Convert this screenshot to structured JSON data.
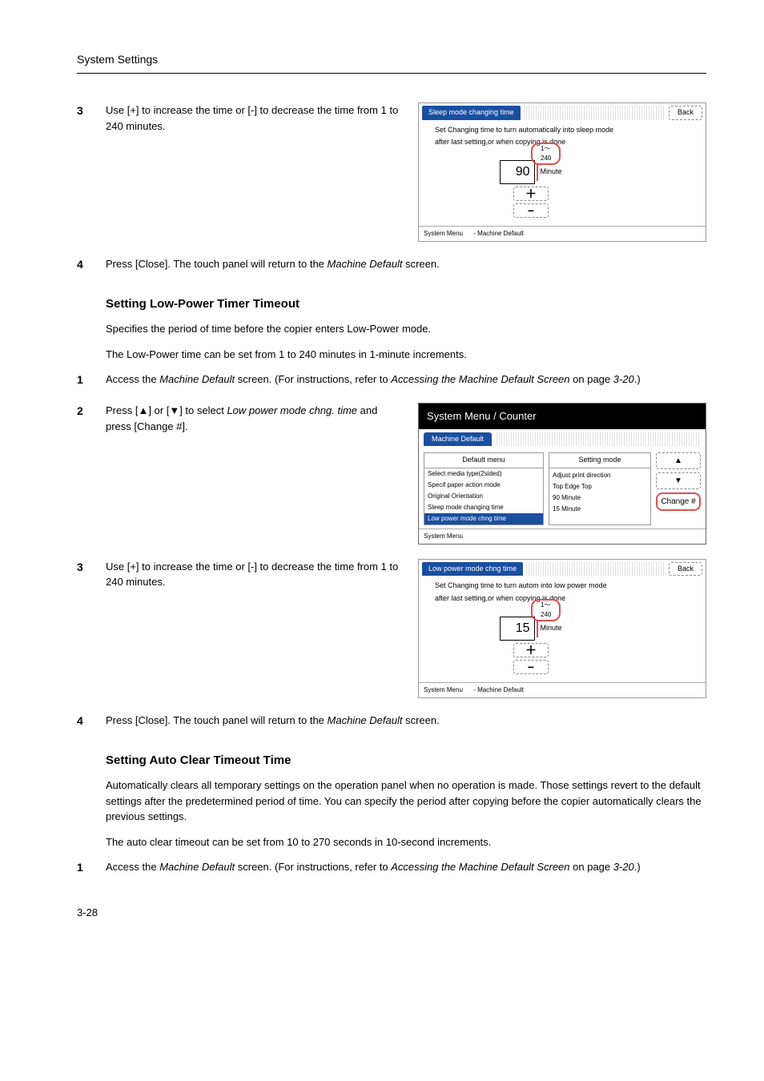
{
  "header": {
    "section": "System Settings"
  },
  "step3a": {
    "num": "3",
    "text": "Use [+] to increase the time or [-] to decrease the time from 1 to 240 minutes."
  },
  "panel1": {
    "title": "Sleep mode changing time",
    "back": "Back",
    "desc1": "Set Changing time to turn automatically into sleep mode",
    "desc2": "after last setting,or when copying is done",
    "range": "1～240",
    "value": "90",
    "unit": "Minute",
    "plus": "＋",
    "minus": "−",
    "footerLeft": "System Menu",
    "footerRight": "-  Machine Default"
  },
  "step4a": {
    "num": "4",
    "textA": "Press [Close]. The touch panel will return to the ",
    "textItalic": "Machine Default",
    "textB": " screen."
  },
  "sectionA": {
    "heading": "Setting Low-Power Timer Timeout",
    "p1": "Specifies the period of time before the copier enters Low-Power mode.",
    "p2": "The Low-Power time can be set from 1 to 240 minutes in 1-minute increments."
  },
  "step1b": {
    "num": "1",
    "textA": "Access the ",
    "textItalic1": "Machine Default",
    "textB": " screen. (For instructions, refer to ",
    "textItalic2": "Accessing the Machine Default Screen",
    "textC": " on page ",
    "textItalic3": "3-20",
    "textD": ".)"
  },
  "step2b": {
    "num": "2",
    "textA": "Press [▲] or [▼] to select ",
    "textItalic1": "Low power mode chng. time",
    "textB": " and press [Change #]."
  },
  "panel2": {
    "black": "System Menu / Counter",
    "blueTab": "Machine Default",
    "colHeadL": "Default menu",
    "colHeadR": "Setting mode",
    "rows": [
      {
        "l": "Select media type(2sided)",
        "r": ""
      },
      {
        "l": "Specif paper action mode",
        "r": "Adjust print direction"
      },
      {
        "l": "Original Orientation",
        "r": "Top Edge Top"
      },
      {
        "l": "Sleep mode changing time",
        "r": "90  Minute"
      },
      {
        "l": "Low power mode chng time",
        "r": "15  Minute"
      }
    ],
    "btnUp": "▲",
    "btnDown": "▼",
    "btnChange": "Change #",
    "footer": "System Menu"
  },
  "step3b": {
    "num": "3",
    "text": "Use [+] to increase the time or [-] to decrease the time from 1 to 240 minutes."
  },
  "panel3": {
    "title": "Low power mode chng time",
    "back": "Back",
    "desc1": "Set Changing time to turn autom into low power mode",
    "desc2": "after last setting,or when copying is done",
    "range": "1～240",
    "value": "15",
    "unit": "Minute",
    "plus": "＋",
    "minus": "−",
    "footerLeft": "System Menu",
    "footerRight": "-  Machine Default"
  },
  "step4b": {
    "num": "4",
    "textA": "Press [Close]. The touch panel will return to the ",
    "textItalic": "Machine Default",
    "textB": " screen."
  },
  "sectionB": {
    "heading": "Setting Auto Clear Timeout Time",
    "p1": "Automatically clears all temporary settings on the operation panel when no operation is made. Those settings revert to the default settings after the predetermined period of time. You can specify the period after copying before the copier automatically clears the previous settings.",
    "p2": "The auto clear timeout can be set from 10 to 270 seconds in 10-second increments."
  },
  "step1c": {
    "num": "1",
    "textA": "Access the ",
    "textItalic1": "Machine Default",
    "textB": " screen. (For instructions, refer to ",
    "textItalic2": "Accessing the Machine Default Screen",
    "textC": " on page ",
    "textItalic3": "3-20",
    "textD": ".)"
  },
  "pageNum": "3-28"
}
